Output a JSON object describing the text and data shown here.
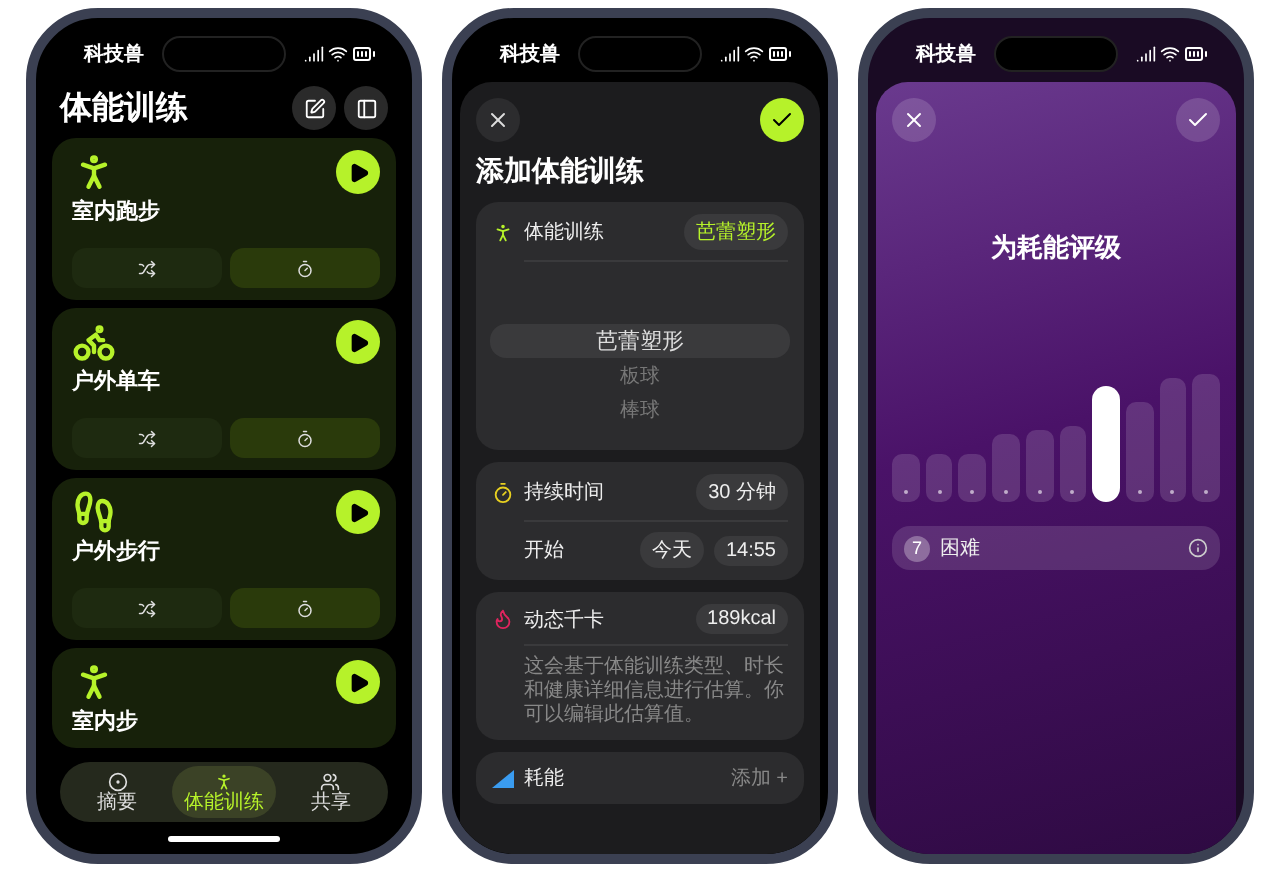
{
  "workouts_screen": {
    "status_bar": {
      "carrier": "科技兽"
    },
    "title": "体能训练",
    "workouts": [
      {
        "name": "室内跑步",
        "kind": "treadmill",
        "actions_visible": true
      },
      {
        "name": "户外单车",
        "kind": "bike",
        "actions_visible": true
      },
      {
        "name": "户外步行",
        "kind": "walk",
        "actions_visible": true
      },
      {
        "name": "室内步",
        "kind": "treadmill",
        "actions_visible": false
      }
    ],
    "tabs": [
      {
        "label": "摘要",
        "kind": "summary",
        "selected": false
      },
      {
        "label": "体能训练",
        "kind": "workout",
        "selected": true
      },
      {
        "label": "共享",
        "kind": "sharing",
        "selected": false
      }
    ]
  },
  "add_workout_screen": {
    "status_bar": {
      "carrier": "科技兽"
    },
    "title": "添加体能训练",
    "type_row": {
      "label": "体能训练",
      "value": "芭蕾塑形"
    },
    "picker": [
      {
        "label": "芭蕾塑形",
        "selected": true
      },
      {
        "label": "板球",
        "selected": false
      },
      {
        "label": "棒球",
        "selected": false
      }
    ],
    "duration": {
      "label": "持续时间",
      "value": "30 分钟"
    },
    "start": {
      "label": "开始",
      "date": "今天",
      "time": "14:55"
    },
    "calories": {
      "label": "动态千卡",
      "value": "189kcal",
      "note": "这会基于体能训练类型、时长和健康详细信息进行估算。你可以编辑此估算值。"
    },
    "effort": {
      "label": "耗能",
      "action": "添加",
      "action_symbol": "+"
    }
  },
  "effort_screen": {
    "status_bar": {
      "carrier": "科技兽"
    },
    "title": "为耗能评级",
    "steps": [
      {
        "selected": false
      },
      {
        "selected": false
      },
      {
        "selected": false
      },
      {
        "selected": false
      },
      {
        "selected": false
      },
      {
        "selected": false
      },
      {
        "selected": true
      },
      {
        "selected": false
      },
      {
        "selected": false
      },
      {
        "selected": false
      }
    ],
    "rating": {
      "number": "7",
      "label": "困难"
    }
  }
}
